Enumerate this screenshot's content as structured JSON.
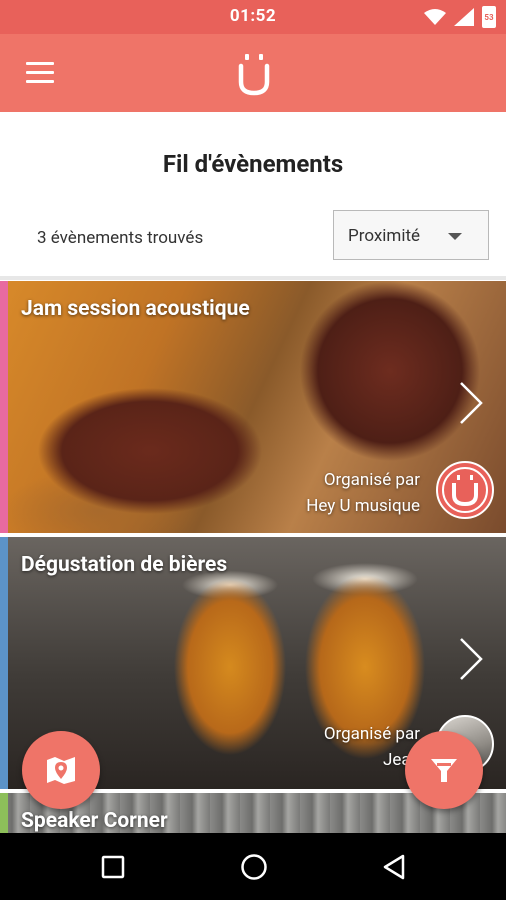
{
  "status_bar": {
    "time": "01:52",
    "battery_level": "53"
  },
  "app_bar": {
    "menu_icon": "hamburger-menu-icon",
    "logo_icon": "u-logo-icon"
  },
  "page": {
    "title": "Fil d'évènements"
  },
  "results": {
    "count_text": "3 évènements trouvés"
  },
  "sort": {
    "selected": "Proximité"
  },
  "events": [
    {
      "title": "Jam session acoustique",
      "organizer_label": "Organisé par",
      "organizer": "Hey U musique",
      "accent_color": "#e86aa0"
    },
    {
      "title": "Dégustation de bières",
      "organizer_label": "Organisé par",
      "organizer": "Jean",
      "accent_color": "#5c93c8"
    },
    {
      "title": "Speaker Corner",
      "accent_color": "#8dbf5a"
    }
  ],
  "fabs": {
    "map_icon": "map-pin-icon",
    "filter_icon": "filter-funnel-icon"
  },
  "colors": {
    "brand": "#ef7468",
    "status": "#e8615a"
  }
}
